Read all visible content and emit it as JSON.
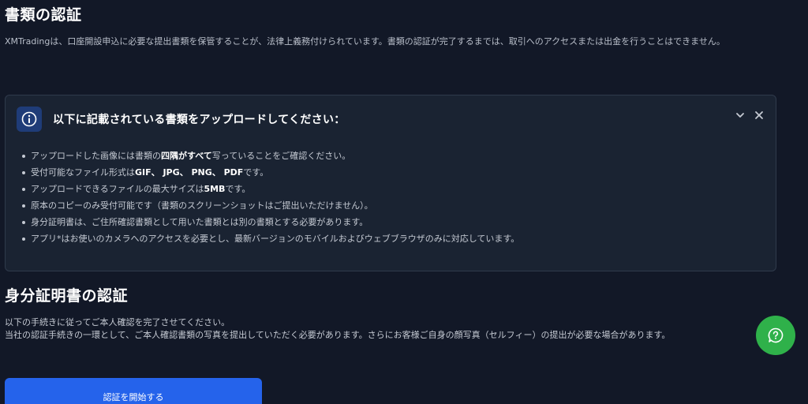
{
  "document_verification": {
    "title": "書類の認証",
    "intro": "XMTradingは、口座開設申込に必要な提出書類を保管することが、法律上義務付けられています。書類の認証が完了するまでは、取引へのアクセスまたは出金を行うことはできません。"
  },
  "notice": {
    "icon": "info-icon",
    "title": "以下に記載されている書類をアップロードしてください：",
    "collapse_icon": "chevron-down-icon",
    "close_icon": "close-icon",
    "items": [
      {
        "pre": "アップロードした画像には書類の",
        "bold": "四隅がすべて",
        "post": "写っていることをご確認ください。"
      },
      {
        "pre": "受付可能なファイル形式は",
        "bold": "GIF、 JPG、 PNG、 PDF",
        "post": "です。"
      },
      {
        "pre": "アップロードできるファイルの最大サイズは",
        "bold": "5MB",
        "post": "です。"
      },
      {
        "pre": "原本のコピーのみ受付可能です（書類のスクリーンショットはご提出いただけません）。",
        "bold": "",
        "post": ""
      },
      {
        "pre": "身分証明書は、ご住所確認書類として用いた書類とは別の書類とする必要があります。",
        "bold": "",
        "post": ""
      },
      {
        "pre": "アプリ*はお使いのカメラへのアクセスを必要とし、最新バージョンのモバイルおよびウェブブラウザのみに対応しています。",
        "bold": "",
        "post": ""
      }
    ]
  },
  "id_verification": {
    "title": "身分証明書の認証",
    "line1": "以下の手続きに従ってご本人確認を完了させてください。",
    "line2": "当社の認証手続きの一環として、ご本人確認書類の写真を提出していただく必要があります。さらにお客様ご自身の顔写真（セルフィー）の提出が必要な場合があります。",
    "start_button_label": "認証を開始する"
  },
  "help": {
    "icon": "help-chat-icon"
  },
  "colors": {
    "background": "#121827",
    "panel": "#1a2332",
    "accent_button": "#2563eb",
    "help_button": "#2fb14a",
    "info_icon_bg": "#1f3c78"
  }
}
